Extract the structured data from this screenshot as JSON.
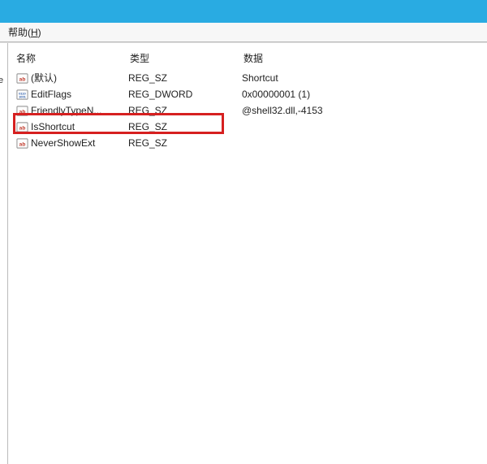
{
  "menu": {
    "help_label": "帮助(H)"
  },
  "left_stub": "e",
  "columns": {
    "name": "名称",
    "type": "类型",
    "data": "数据"
  },
  "rows": [
    {
      "icon": "str",
      "name": "(默认)",
      "type": "REG_SZ",
      "data": "Shortcut"
    },
    {
      "icon": "bin",
      "name": "EditFlags",
      "type": "REG_DWORD",
      "data": "0x00000001 (1)"
    },
    {
      "icon": "str",
      "name": "FriendlyTypeN...",
      "type": "REG_SZ",
      "data": "@shell32.dll,-4153"
    },
    {
      "icon": "str",
      "name": "IsShortcut",
      "type": "REG_SZ",
      "data": ""
    },
    {
      "icon": "str",
      "name": "NeverShowExt",
      "type": "REG_SZ",
      "data": ""
    }
  ],
  "highlight_row_index": 3
}
